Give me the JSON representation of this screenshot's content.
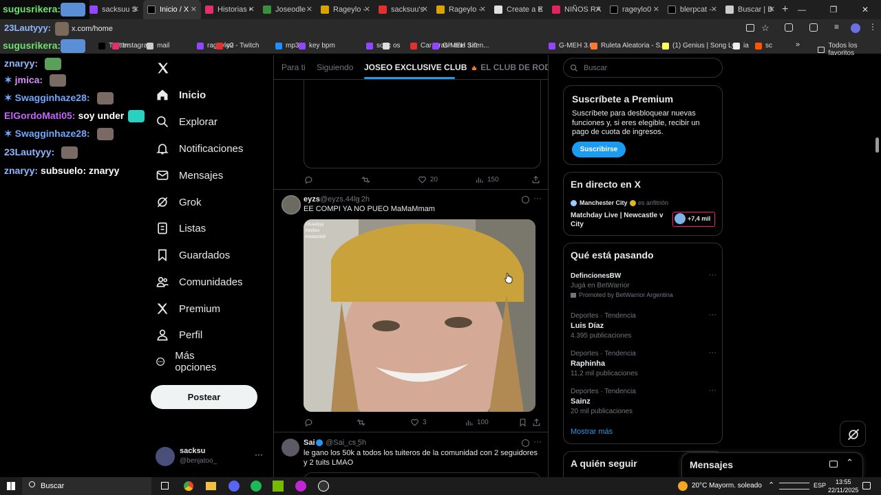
{
  "browser": {
    "tabs": [
      {
        "label": "sacksuu S",
        "color": "#9146ff",
        "active": false
      },
      {
        "label": "Inicio / X",
        "color": "#000000",
        "active": true
      },
      {
        "label": "Historias •",
        "color": "#e1306c",
        "active": false
      },
      {
        "label": "Joseodle",
        "color": "#3a8f3a",
        "active": false
      },
      {
        "label": "Rageylo -",
        "color": "#d9a400",
        "active": false
      },
      {
        "label": "sacksuu's",
        "color": "#e03030",
        "active": false
      },
      {
        "label": "Rageylo -",
        "color": "#d9a400",
        "active": false
      },
      {
        "label": "Create a E",
        "color": "#e0e0e0",
        "active": false
      },
      {
        "label": "NIÑOS RA",
        "color": "#e0245e",
        "active": false
      },
      {
        "label": "rageylo0",
        "color": "#000000",
        "active": false
      },
      {
        "label": "blerpcat -",
        "color": "#000000",
        "active": false
      },
      {
        "label": "Buscar | B",
        "color": "#cccccc",
        "active": false
      }
    ],
    "url": "x.com/home",
    "bookmarks": [
      {
        "label": "Twitter",
        "color": "#000000"
      },
      {
        "label": "Instagram",
        "color": "#e1306c"
      },
      {
        "label": "mail",
        "color": "#cccccc"
      },
      {
        "label": "rageylo0 - Twitch",
        "color": "#9146ff"
      },
      {
        "label": "y2",
        "color": "#e03030"
      },
      {
        "label": "mp3",
        "color": "#1e90ff"
      },
      {
        "label": "key bpm",
        "color": "#9146ff"
      },
      {
        "label": "soec",
        "color": "#9146ff"
      },
      {
        "label": "os",
        "color": "#dddddd"
      },
      {
        "label": "Car Crash and Siren...",
        "color": "#e03030"
      },
      {
        "label": "G-MEH 3.0",
        "color": "#9146ff"
      },
      {
        "label": "G-MEH 3.0",
        "color": "#9146ff"
      },
      {
        "label": "Ruleta Aleatoria - S...",
        "color": "#ff7733"
      },
      {
        "label": "(1) Genius | Song Ly...",
        "color": "#ffff64"
      },
      {
        "label": "ia",
        "color": "#eeeeee"
      },
      {
        "label": "sc",
        "color": "#ff5500"
      }
    ],
    "all_bookmarks": "Todos los favoritos"
  },
  "overlay": {
    "banner_name": "sugusrikera:",
    "address_user": "23Lautyyy:",
    "chat": [
      {
        "user": "znaryy:",
        "msg": "",
        "color": "#8fb8ff"
      },
      {
        "user": "jmica:",
        "msg": "",
        "color": "#d48cff"
      },
      {
        "user": "Swagginhaze28:",
        "msg": "",
        "color": "#6fa8ff"
      },
      {
        "user": "ElGordoMati05:",
        "msg": "soy under",
        "color": "#c466ff"
      },
      {
        "user": "Swagginhaze28:",
        "msg": "",
        "color": "#6fa8ff"
      },
      {
        "user": "23Lautyyy:",
        "msg": "",
        "color": "#8fb8ff"
      },
      {
        "user": "znaryy:",
        "msg": "subsuelo: znaryy",
        "color": "#8fb8ff"
      }
    ]
  },
  "sidebar": {
    "nav": [
      "Inicio",
      "Explorar",
      "Notificaciones",
      "Mensajes",
      "Grok",
      "Listas",
      "Guardados",
      "Comunidades",
      "Premium",
      "Perfil",
      "Más opciones"
    ],
    "post_button": "Postear",
    "account": {
      "name": "sacksu",
      "handle": "@benjatoo_"
    }
  },
  "main": {
    "tabs": [
      "Para ti",
      "Siguiendo",
      "JOSEO EXCLUSIVE CLUB",
      "EL CLUB DE RODSQU"
    ],
    "first_tweet_actions": {
      "replies": "",
      "retweets": "",
      "likes": "20",
      "views": "150"
    },
    "tweet": {
      "name": "eyzs",
      "handle": "@eyzs.44lg",
      "time": "· 2h",
      "text": "EE COMPI YA NO PUEO MaMaMmam",
      "media_overlay": [
        "23Lautyyy",
        "Xitnitioo",
        "moutarstaft"
      ],
      "actions": {
        "replies": "",
        "retweets": "",
        "likes": "3",
        "views": "100"
      }
    },
    "tweet2": {
      "name": "Sai",
      "handle": "@Sai_cs_",
      "time": "· 5h",
      "text": "le gano los 50k a todos los tuiteros de la comunidad con 2 seguidores y 2 tuits LMAO"
    }
  },
  "right": {
    "search_placeholder": "Buscar",
    "premium": {
      "title": "Suscríbete a Premium",
      "body": "Suscríbete para desbloquear nuevas funciones y, si eres elegible, recibir un pago de cuota de ingresos.",
      "button": "Suscribirse"
    },
    "live": {
      "title": "En directo en X",
      "host": "Manchester City",
      "host_suffix": "es anfitrión",
      "event": "Matchday Live | Newcastle v City",
      "count": "+7,4 mil"
    },
    "trends": {
      "title": "Qué está pasando",
      "promo": {
        "name": "DefincionesBW",
        "sub": "Jugá en BetWarrior",
        "promoted": "Promoted by BetWarrior Argentina"
      },
      "items": [
        {
          "category": "Deportes · Tendencia",
          "name": "Luis Díaz",
          "count": "4.395 publicaciones"
        },
        {
          "category": "Deportes · Tendencia",
          "name": "Raphinha",
          "count": "11,2 mil publicaciones"
        },
        {
          "category": "Deportes · Tendencia",
          "name": "Sainz",
          "count": "20 mil publicaciones"
        }
      ],
      "show_more": "Mostrar más"
    },
    "who_to_follow": "A quién seguir",
    "messages_dock": "Mensajes"
  },
  "taskbar": {
    "search": "Buscar",
    "weather": "20°C  Mayorm. soleado",
    "lang": "ESP",
    "time": "13:55",
    "date": "22/11/2025"
  },
  "colors": {
    "accent": "#1d9bf0",
    "background": "#000000",
    "border": "#2f3336",
    "muted": "#71767b"
  }
}
